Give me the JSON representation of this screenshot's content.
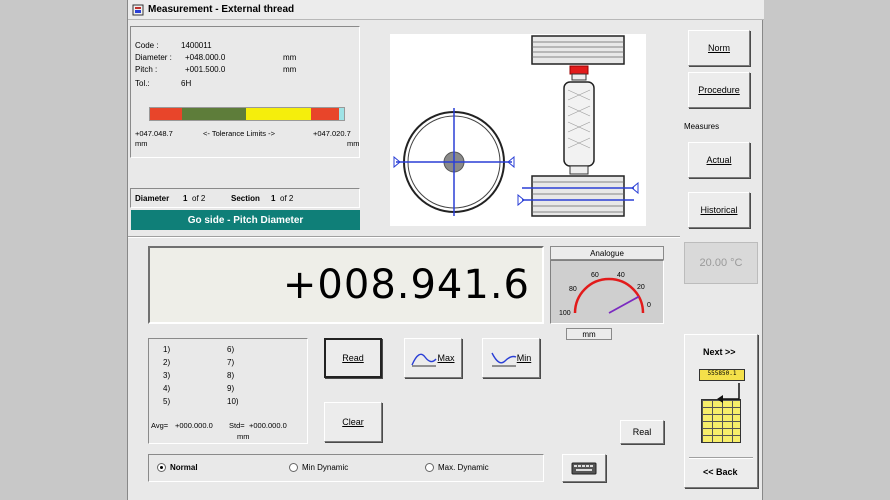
{
  "window": {
    "title": "Measurement - External thread"
  },
  "part": {
    "code_label": "Code :",
    "code": "1400011",
    "diameter_label": "Diameter :",
    "diameter": "+048.000.0",
    "diameter_unit": "mm",
    "pitch_label": "Pitch :",
    "pitch": "+001.500.0",
    "pitch_unit": "mm",
    "tol_label": "Tol.:",
    "tol": "6H"
  },
  "tolerance": {
    "low": "+047.048.7",
    "low_unit": "mm",
    "caption": "<-  Tolerance Limits  ->",
    "high": "+047.020.7",
    "high_unit": "mm",
    "colors": {
      "red": "#e8452a",
      "green": "#5e7d3a",
      "yellow": "#f5ee0c",
      "cyan": "#9fe3e6"
    }
  },
  "position": {
    "diameter_label": "Diameter",
    "diameter_index": "1",
    "diameter_of": "of 2",
    "section_label": "Section",
    "section_index": "1",
    "section_of": "of 2"
  },
  "mode_banner": "Go side - Pitch Diameter",
  "right_panel": {
    "norm": "Norm",
    "procedure": "Procedure",
    "measures_label": "Measures",
    "actual": "Actual",
    "historical": "Historical",
    "temperature": "20.00 °C"
  },
  "reading": {
    "value": "+008.941.6",
    "unit": "mm"
  },
  "gauge": {
    "title": "Analogue",
    "ticks": [
      "100",
      "80",
      "60",
      "40",
      "20",
      "0"
    ],
    "level": 0.16
  },
  "readings": {
    "left": [
      "1)",
      "2)",
      "3)",
      "4)",
      "5)"
    ],
    "right": [
      "6)",
      "7)",
      "8)",
      "9)",
      "10)"
    ],
    "avg_label": "Avg=",
    "avg": "+000.000.0",
    "std_label": "Std=",
    "std": "+000.000.0",
    "unit": "mm"
  },
  "buttons": {
    "read": "Read",
    "max": "Max",
    "min": "Min",
    "clear": "Clear",
    "real": "Real"
  },
  "modes": {
    "normal": "Normal",
    "min_dynamic": "Min Dynamic",
    "max_dynamic": "Max. Dynamic",
    "selected": "Normal"
  },
  "nav": {
    "next": "Next >>",
    "back": "<< Back",
    "thumb_top": "555850.1"
  },
  "accent_colors": {
    "teal": "#0f7f78",
    "blue": "#2a3fd6",
    "red_arc": "#e21b1b"
  }
}
